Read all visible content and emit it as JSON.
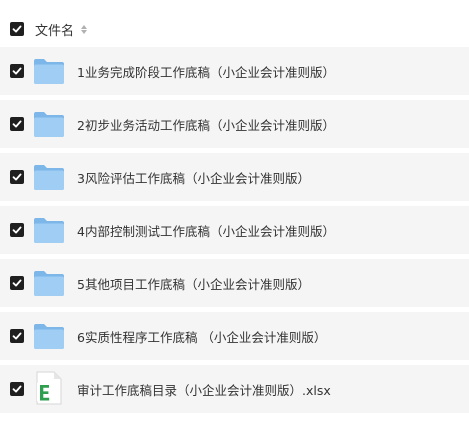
{
  "header": {
    "column_label": "文件名"
  },
  "files": [
    {
      "name": "1业务完成阶段工作底稿（小企业会计准则版）",
      "type": "folder",
      "checked": true
    },
    {
      "name": "2初步业务活动工作底稿（小企业会计准则版）",
      "type": "folder",
      "checked": true
    },
    {
      "name": "3风险评估工作底稿（小企业会计准则版）",
      "type": "folder",
      "checked": true
    },
    {
      "name": "4内部控制测试工作底稿（小企业会计准则版）",
      "type": "folder",
      "checked": true
    },
    {
      "name": "5其他项目工作底稿（小企业会计准则版）",
      "type": "folder",
      "checked": true
    },
    {
      "name": "6实质性程序工作底稿 （小企业会计准则版）",
      "type": "folder",
      "checked": true
    },
    {
      "name": "审计工作底稿目录（小企业会计准则版）.xlsx",
      "type": "xlsx",
      "checked": true
    }
  ],
  "colors": {
    "checkbox": "#1f1f1f",
    "row_background": "#f5f5f5",
    "folder": "#8ec3ef",
    "xlsx_accent": "#2e9e4f"
  },
  "icons": {
    "folder": "folder-icon",
    "xlsx": "excel-file-icon"
  }
}
